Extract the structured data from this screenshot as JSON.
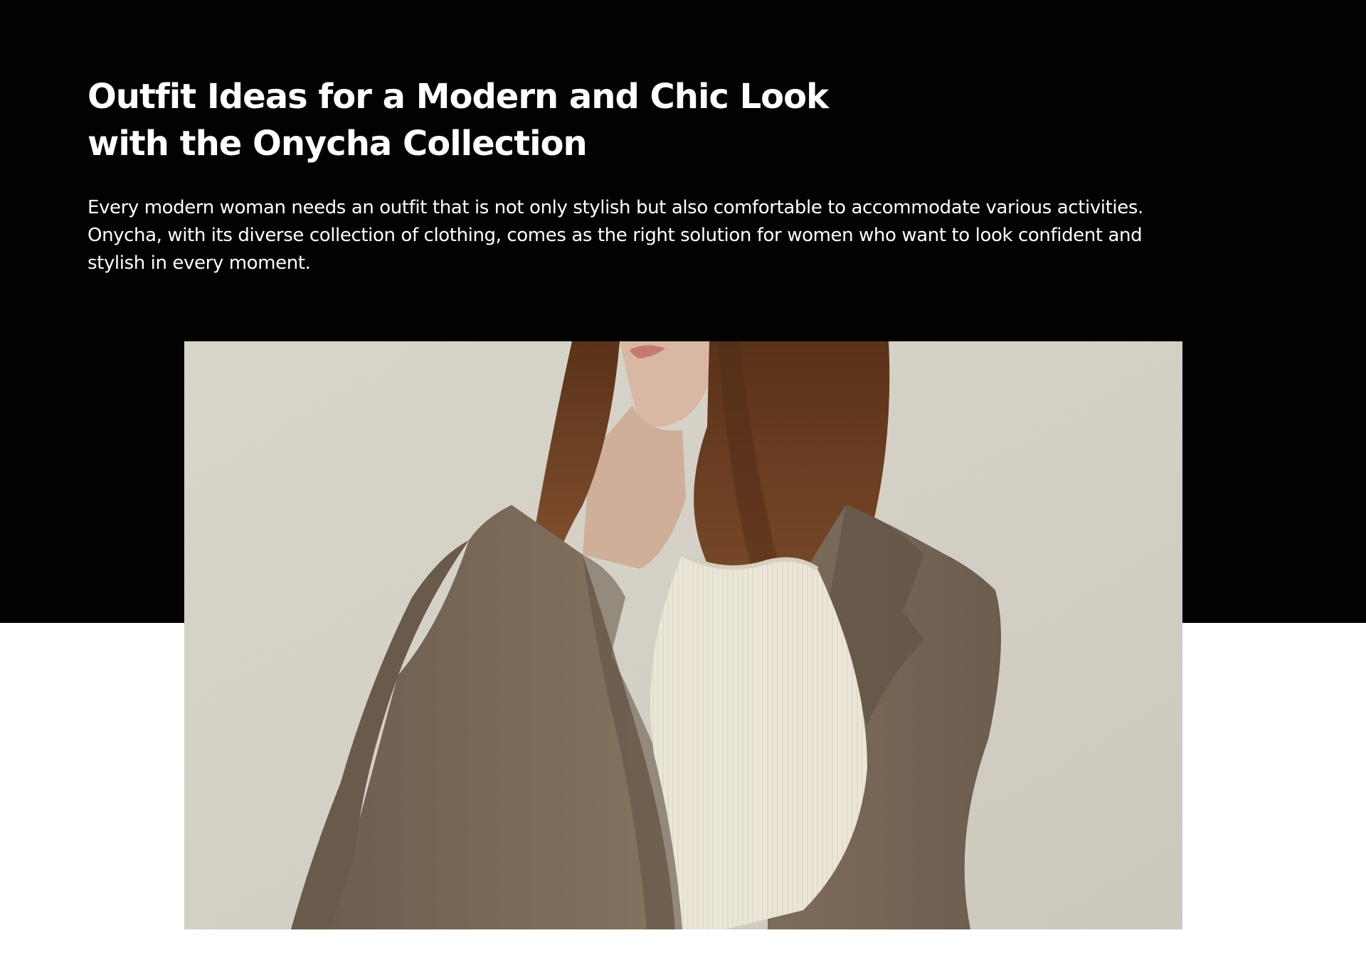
{
  "article": {
    "title_line1": "Outfit Ideas for a Modern and Chic Look",
    "title_line2": "with the Onycha Collection",
    "intro_line1": "Every modern woman needs an outfit that is not only stylish but also comfortable to accommodate various activities.",
    "intro_line2": "Onycha, with its diverse collection of clothing, comes as the right solution for women who want to look confident and",
    "intro_line3": "stylish in every moment."
  },
  "colors": {
    "hero_background": "#020202",
    "page_background": "#ffffff",
    "text": "#ffffff",
    "wall": "#d9d5cb",
    "blazer": "#7a6a5b",
    "top": "#ece7da",
    "hair": "#6b3f24"
  }
}
